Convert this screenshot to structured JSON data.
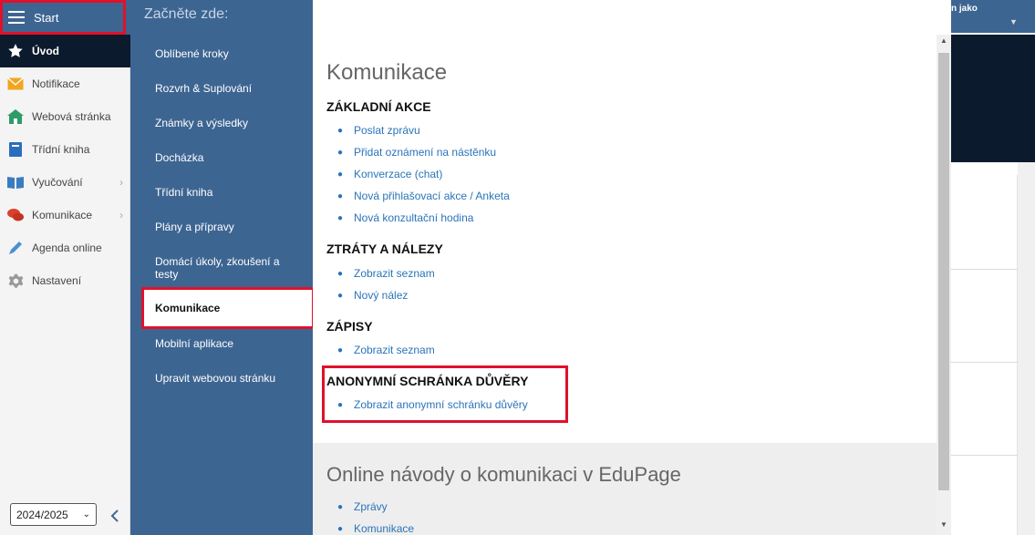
{
  "start": {
    "label": "Start"
  },
  "sidebar": {
    "items": [
      {
        "label": "Úvod",
        "icon": "star-icon"
      },
      {
        "label": "Notifikace",
        "icon": "envelope-icon"
      },
      {
        "label": "Webová stránka",
        "icon": "house-icon"
      },
      {
        "label": "Třídní kniha",
        "icon": "book-icon"
      },
      {
        "label": "Vyučování",
        "icon": "open-book-icon"
      },
      {
        "label": "Komunikace",
        "icon": "chat-icon"
      },
      {
        "label": "Agenda online",
        "icon": "pen-icon"
      },
      {
        "label": "Nastavení",
        "icon": "gear-icon"
      }
    ],
    "year": "2024/2025"
  },
  "menu": {
    "header": "Začněte zde:",
    "items": [
      "Oblíbené kroky",
      "Rozvrh & Suplování",
      "Známky a výsledky",
      "Docházka",
      "Třídní kniha",
      "Plány a přípravy",
      "Domácí úkoly, zkoušení a testy",
      "Komunikace",
      "Mobilní aplikace",
      "Upravit webovou stránku"
    ]
  },
  "topbar": {
    "user_text": "n jako"
  },
  "content": {
    "title": "Komunikace",
    "sections": [
      {
        "heading": "ZÁKLADNÍ AKCE",
        "links": [
          "Poslat zprávu",
          "Přidat oznámení na nástěnku",
          "Konverzace (chat)",
          "Nová přihlašovací akce / Anketa",
          "Nová konzultační hodina"
        ]
      },
      {
        "heading": "ZTRÁTY A NÁLEZY",
        "links": [
          "Zobrazit seznam",
          "Nový nález"
        ]
      },
      {
        "heading": "ZÁPISY",
        "links": [
          "Zobrazit seznam"
        ]
      },
      {
        "heading": "ANONYMNÍ SCHRÁNKA DŮVĚRY",
        "links": [
          "Zobrazit anonymní schránku důvěry"
        ]
      }
    ],
    "guides_title": "Online návody o komunikaci v EduPage",
    "guides": [
      "Zprávy",
      "Komunikace"
    ]
  },
  "colors": {
    "header_blue": "#3d6592",
    "dark_navy": "#0b1a2c",
    "highlight_red": "#e0112b",
    "link_blue": "#2a74b8"
  }
}
